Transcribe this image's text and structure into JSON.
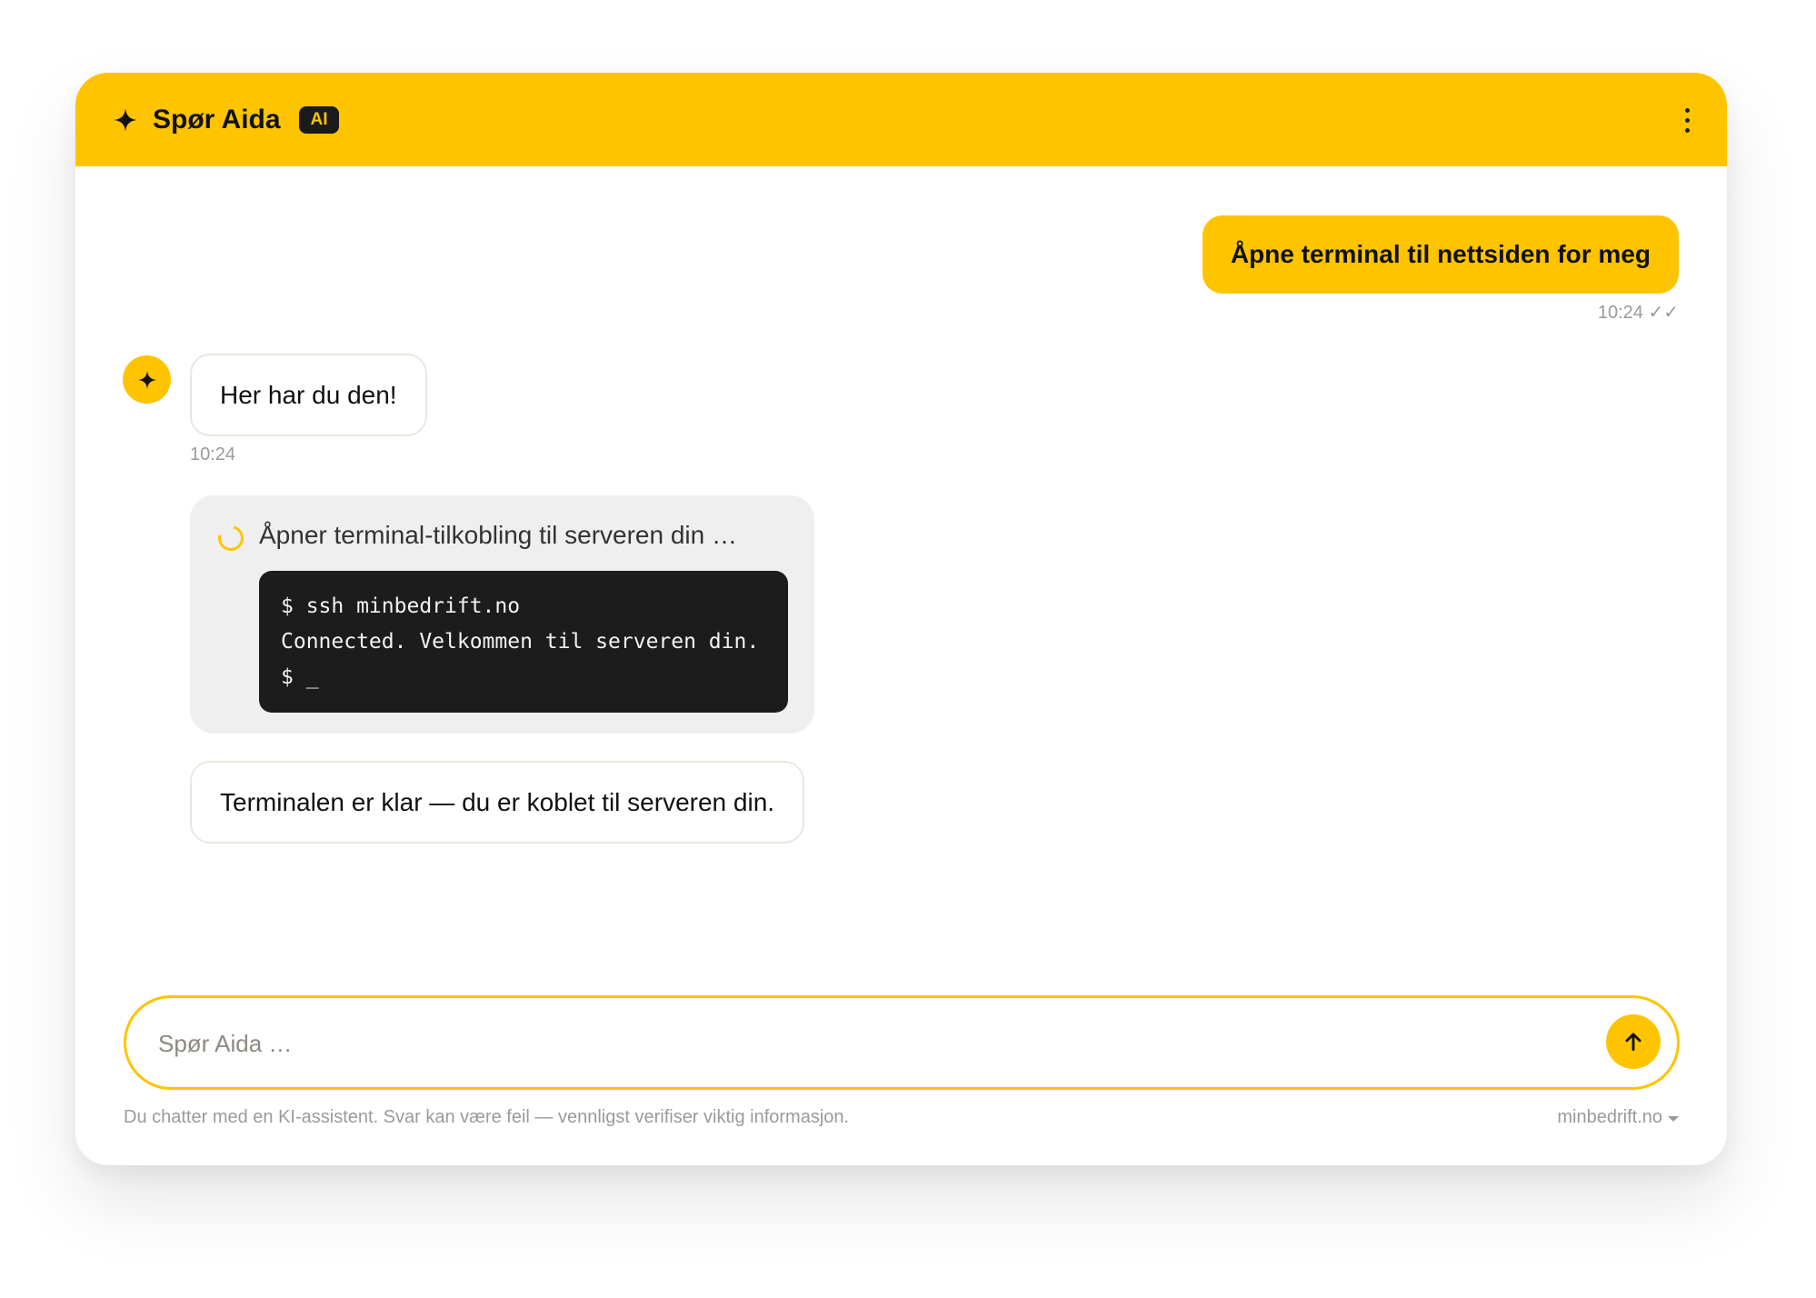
{
  "header": {
    "title": "Spør Aida",
    "badge": "AI",
    "sparkle_icon": "sparkle-icon",
    "menu_icon": "more-vertical-icon"
  },
  "colors": {
    "brand": "#FFC400",
    "terminal_bg": "#1C1C1C",
    "muted": "#9A9A9A"
  },
  "messages": {
    "user": {
      "text": "Åpne terminal til nettsiden for meg",
      "time": "10:24 ✓✓"
    },
    "assistant_1": {
      "text": "Her har du den!",
      "time": "10:24"
    },
    "tool": {
      "status": "Åpner terminal-tilkobling til serveren din …",
      "terminal_lines": [
        "$ ssh minbedrift.no",
        "Connected. Velkommen til serveren din.",
        "$ _"
      ]
    },
    "assistant_2": {
      "text": "Terminalen er klar — du er koblet til serveren din."
    }
  },
  "input": {
    "placeholder": "Spør Aida …",
    "value": "",
    "send_icon": "arrow-up-icon"
  },
  "footer": {
    "disclaimer": "Du chatter med en KI-assistent. Svar kan være feil — vennligst verifiser viktig informasjon.",
    "site": "minbedrift.no"
  }
}
